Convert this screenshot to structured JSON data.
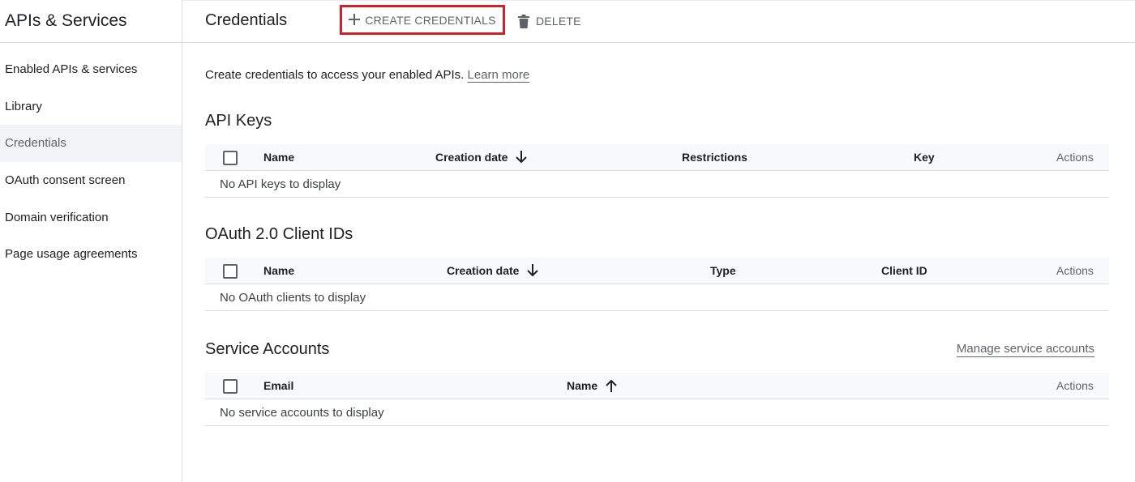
{
  "sidebar": {
    "title": "APIs & Services",
    "items": [
      {
        "label": "Enabled APIs & services"
      },
      {
        "label": "Library"
      },
      {
        "label": "Credentials"
      },
      {
        "label": "OAuth consent screen"
      },
      {
        "label": "Domain verification"
      },
      {
        "label": "Page usage agreements"
      }
    ],
    "active_index": 2
  },
  "toolbar": {
    "title": "Credentials",
    "create_label": "CREATE CREDENTIALS",
    "delete_label": "DELETE"
  },
  "intro": {
    "text": "Create credentials to access your enabled APIs.",
    "link": "Learn more"
  },
  "api_keys": {
    "title": "API Keys",
    "columns": [
      "Name",
      "Creation date",
      "Restrictions",
      "Key",
      "Actions"
    ],
    "empty": "No API keys to display"
  },
  "oauth": {
    "title": "OAuth 2.0 Client IDs",
    "columns": [
      "Name",
      "Creation date",
      "Type",
      "Client ID",
      "Actions"
    ],
    "empty": "No OAuth clients to display"
  },
  "service_accounts": {
    "title": "Service Accounts",
    "manage_link": "Manage service accounts",
    "columns": [
      "Email",
      "Name",
      "Actions"
    ],
    "empty": "No service accounts to display"
  },
  "colors": {
    "highlight_border": "#d0202a",
    "active_nav_bg": "#f1f3f4"
  },
  "icons": {
    "create": "plus-icon",
    "delete": "trash-icon",
    "sort_desc": "arrow-down-icon",
    "sort_asc": "arrow-up-icon"
  }
}
